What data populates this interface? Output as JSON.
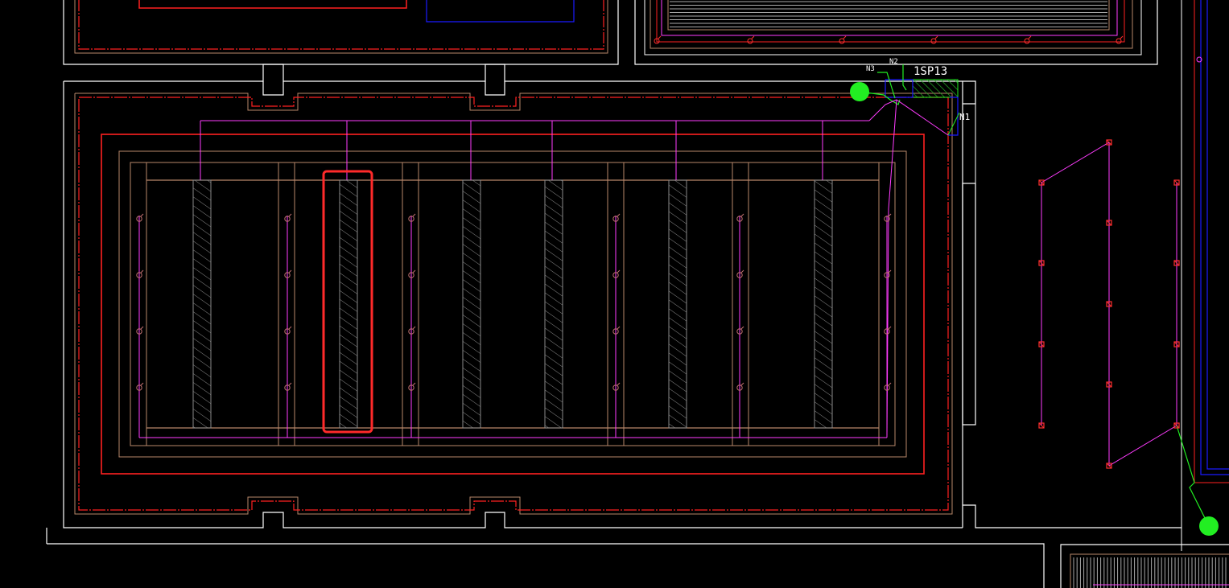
{
  "viewport": {
    "background": "#000000"
  },
  "labels": {
    "panel_id": "1SP13",
    "n1": "N1",
    "n2": "N2",
    "n3": "N3"
  },
  "colors": {
    "wall": "#ffffff",
    "boundary": "#ff2020",
    "inner_frame": "#b8876a",
    "circuit": "#ff3cff",
    "blue_zone": "#1a1aff",
    "node": "#22ee22",
    "hatch": "#8a8a8a",
    "selection": "#ff2a2a"
  },
  "selection": {
    "name": "selected-hatch-strip",
    "state": "highlighted"
  }
}
